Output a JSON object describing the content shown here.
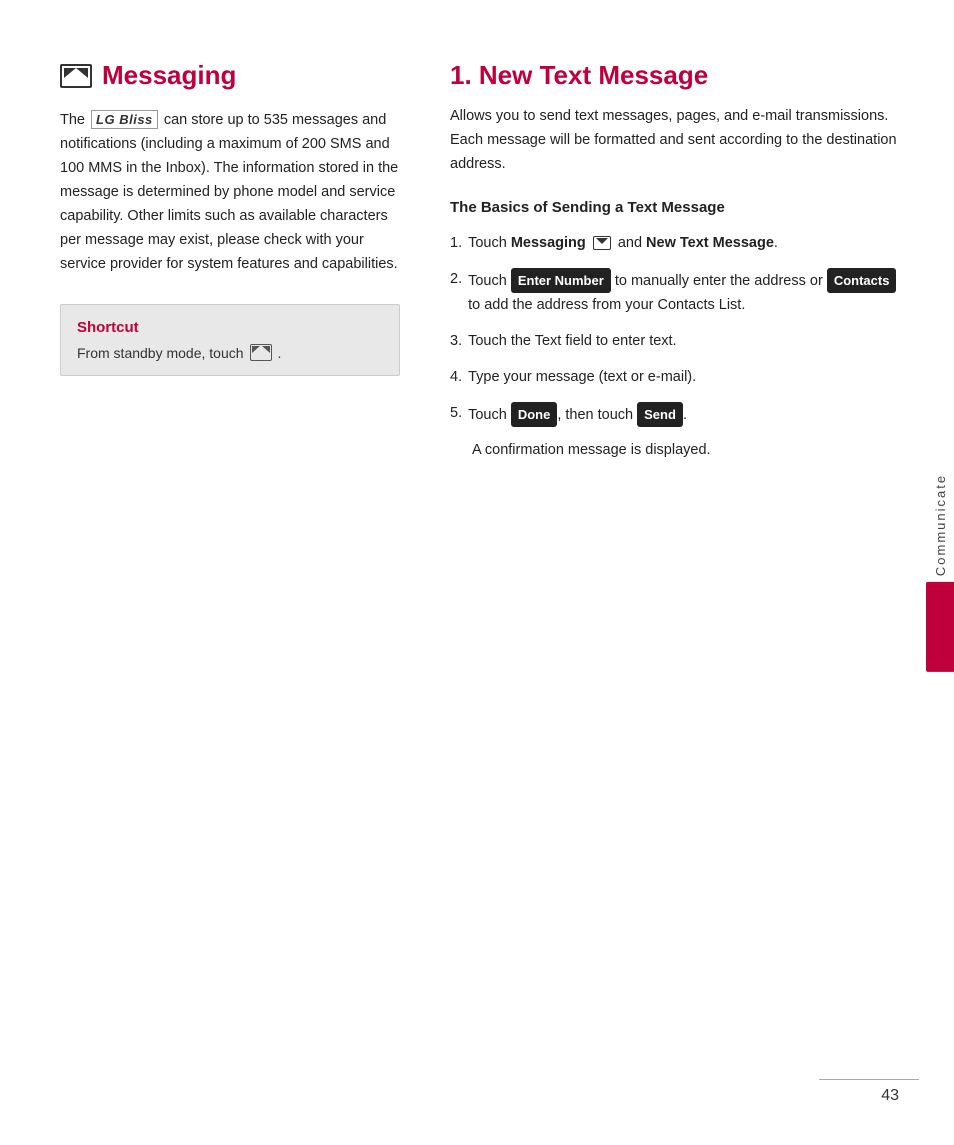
{
  "page": {
    "number": "43",
    "side_tab_label": "Communicate"
  },
  "left": {
    "section_icon_alt": "messaging-envelope-icon",
    "section_title": "Messaging",
    "brand_name": "LG Bliss",
    "body_text_1": "The",
    "body_text_2": "can store up to 535 messages and notifications (including a maximum of 200 SMS and 100 MMS in the Inbox). The information stored in the message is determined by phone model and service capability. Other limits such as available characters per message may exist, please check with your service provider for system features and capabilities.",
    "shortcut": {
      "title": "Shortcut",
      "text": "From standby mode, touch"
    }
  },
  "right": {
    "section_title": "1. New Text Message",
    "intro": "Allows you to send text messages, pages, and e-mail transmissions. Each message will be formatted and sent according to the destination address.",
    "subsection_title": "The Basics of Sending a Text Message",
    "steps": [
      {
        "num": "1.",
        "text_before": "Touch",
        "bold": "Messaging",
        "icon": true,
        "text_middle": "and",
        "bold2": "New Text Message",
        "text_after": "."
      },
      {
        "num": "2.",
        "text_before": "Touch",
        "kbd1": "Enter Number",
        "text_middle": "to manually enter the address or",
        "kbd2": "Contacts",
        "text_end": "to add the address from your Contacts List."
      },
      {
        "num": "3.",
        "text": "Touch the Text field to enter text."
      },
      {
        "num": "4.",
        "text": "Type your message (text or e-mail)."
      },
      {
        "num": "5.",
        "text_before": "Touch",
        "kbd1": "Done",
        "text_middle": ", then touch",
        "kbd2": "Send",
        "text_after": "."
      }
    ],
    "confirmation_note": "A confirmation message is displayed."
  }
}
